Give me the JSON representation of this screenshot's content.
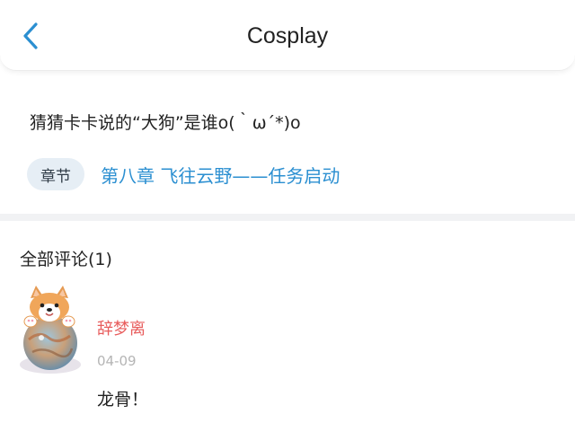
{
  "header": {
    "title": "Cosplay",
    "back_icon": "chevron-left-icon",
    "accent_color": "#2b8fd1"
  },
  "post": {
    "question": "猜猜卡卡说的“大狗”是谁o(｀ω´*)o",
    "chapter_tag": "章节",
    "chapter_link": "第八章  飞往云野——任务启动"
  },
  "comments": {
    "heading": "全部评论(1)",
    "items": [
      {
        "username": "辞梦离",
        "date": "04-09",
        "text": "龙骨！",
        "avatar_icon": "corgi-avatar-icon",
        "username_color": "#e85d5d"
      }
    ]
  }
}
